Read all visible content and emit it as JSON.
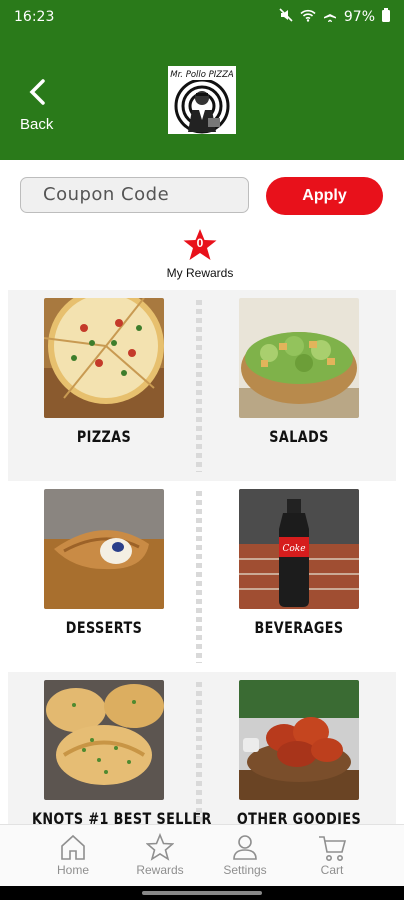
{
  "status_bar": {
    "time": "16:23",
    "battery": "97%"
  },
  "header": {
    "back_label": "Back",
    "logo_text": "Mr. Pollo PIZZA"
  },
  "coupon": {
    "placeholder": "Coupon Code",
    "apply_label": "Apply"
  },
  "rewards": {
    "count": "0",
    "label": "My Rewards"
  },
  "categories": [
    {
      "name": "PIZZAS"
    },
    {
      "name": "SALADS"
    },
    {
      "name": "DESSERTS"
    },
    {
      "name": "BEVERAGES"
    },
    {
      "name": "KNOTS #1 BEST SELLER"
    },
    {
      "name": "OTHER GOODIES"
    }
  ],
  "bottom_nav": [
    {
      "label": "Home",
      "icon": "home-icon"
    },
    {
      "label": "Rewards",
      "icon": "star-icon"
    },
    {
      "label": "Settings",
      "icon": "person-icon"
    },
    {
      "label": "Cart",
      "icon": "cart-icon"
    }
  ],
  "colors": {
    "brand_green": "#2a7a1a",
    "accent_red": "#e8111b"
  }
}
